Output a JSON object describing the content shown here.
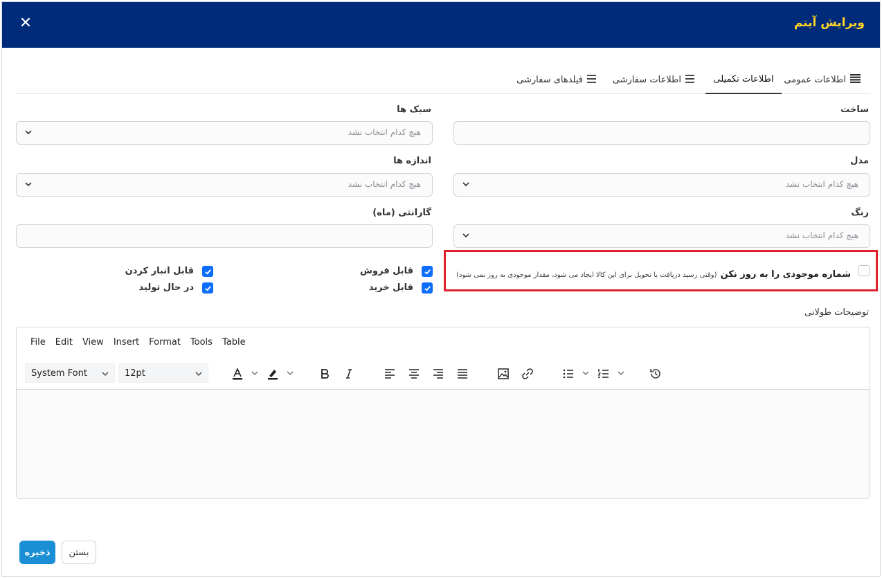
{
  "modal": {
    "title": "ویرایش آیتم",
    "close_symbol": "✕"
  },
  "tabs": [
    {
      "label": "اطلاعات عمومی",
      "icon": "list-icon",
      "active": false
    },
    {
      "label": "اطلاعات تکمیلی",
      "icon": "",
      "active": true
    },
    {
      "label": "اطلاعات سفارشی",
      "icon": "menu-icon",
      "active": false
    },
    {
      "label": "فیلدهای سفارشی",
      "icon": "menu-icon",
      "active": false
    }
  ],
  "fields": {
    "make": {
      "label": "ساخت",
      "value": ""
    },
    "styles": {
      "label": "سبک ها",
      "placeholder": "هیچ کدام انتخاب نشد"
    },
    "model": {
      "label": "مدل",
      "placeholder": "هیچ کدام انتخاب نشد"
    },
    "sizes": {
      "label": "اندازه ها",
      "placeholder": "هیچ کدام انتخاب نشد"
    },
    "color": {
      "label": "رنگ",
      "placeholder": "هیچ کدام انتخاب نشد"
    },
    "warranty": {
      "label": "گارانتی (ماه)",
      "value": ""
    }
  },
  "stock_update": {
    "label": "شماره موجودی را به روز نکن",
    "hint": "(وقتی رسید دریافت یا تحویل برای این کالا ایجاد می شود، مقدار موجودی به روز نمی شود)",
    "checked": false
  },
  "checkboxes": {
    "sellable": {
      "label": "قابل فروش",
      "checked": true
    },
    "purchasable": {
      "label": "قابل خرید",
      "checked": true
    },
    "stockable": {
      "label": "قابل انبار کردن",
      "checked": true
    },
    "in_production": {
      "label": "در حال تولید",
      "checked": true
    }
  },
  "long_description": {
    "label": "توضیحات طولانی",
    "menu": [
      "File",
      "Edit",
      "View",
      "Insert",
      "Format",
      "Tools",
      "Table"
    ],
    "font_family": "System Font",
    "font_size": "12pt"
  },
  "footer": {
    "save_label": "ذخیره",
    "close_label": "بستن"
  },
  "colors": {
    "header_bg": "#002b7a",
    "title": "#ffd426",
    "primary": "#1a8fd6",
    "checkbox": "#0d6efd",
    "highlight": "#e0202b"
  }
}
